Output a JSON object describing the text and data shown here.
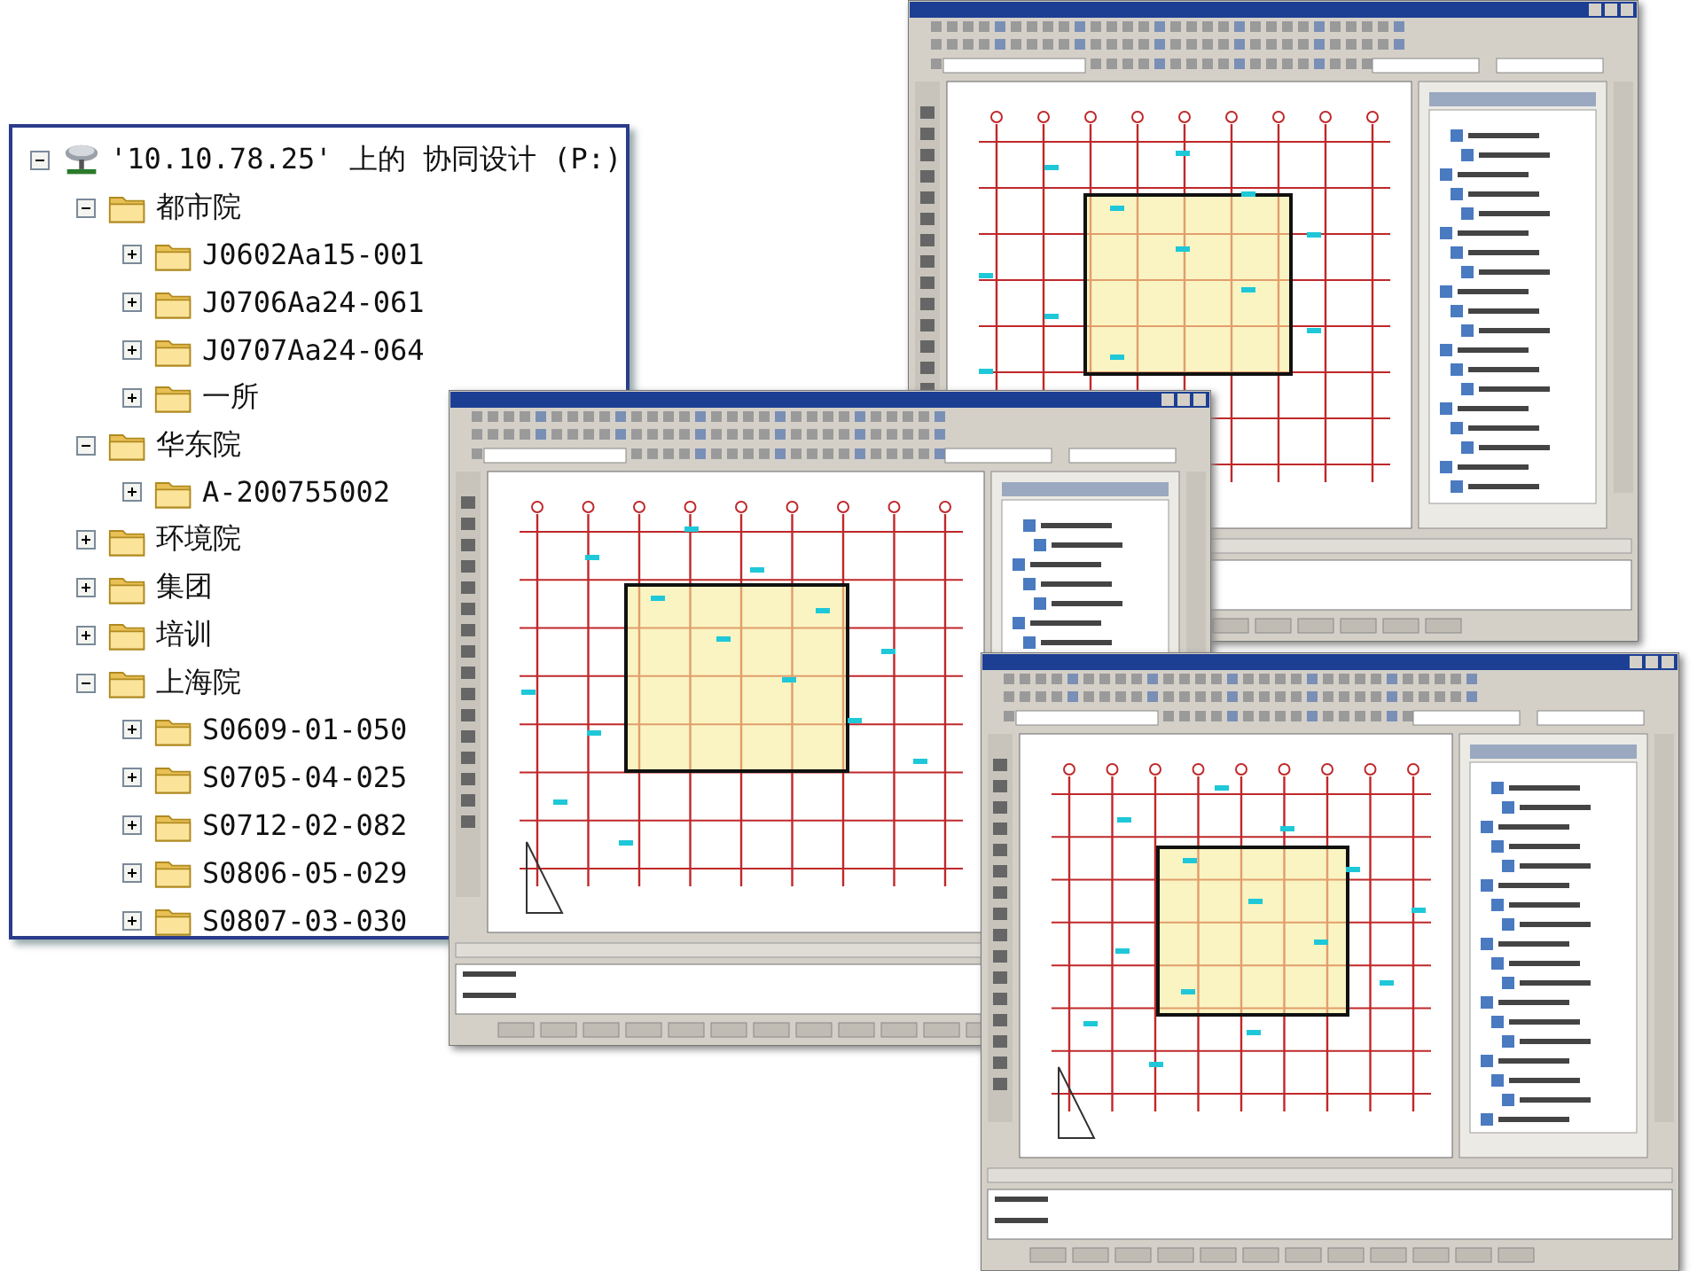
{
  "folder_tree": {
    "root": {
      "label": "'10.10.78.25' 上的 协同设计 (P:)",
      "kind": "network-drive",
      "expanded": true,
      "children": [
        {
          "label": "都市院",
          "kind": "folder",
          "expanded": true,
          "children": [
            {
              "label": "J0602Aa15-001",
              "kind": "folder",
              "expanded": false
            },
            {
              "label": "J0706Aa24-061",
              "kind": "folder",
              "expanded": false
            },
            {
              "label": "J0707Aa24-064",
              "kind": "folder",
              "expanded": false
            },
            {
              "label": "一所",
              "kind": "folder",
              "expanded": false
            }
          ]
        },
        {
          "label": "华东院",
          "kind": "folder",
          "expanded": true,
          "children": [
            {
              "label": "A-200755002",
              "kind": "folder",
              "expanded": false
            }
          ]
        },
        {
          "label": "环境院",
          "kind": "folder",
          "expanded": false
        },
        {
          "label": "集团",
          "kind": "folder",
          "expanded": false
        },
        {
          "label": "培训",
          "kind": "folder",
          "expanded": false
        },
        {
          "label": "上海院",
          "kind": "folder",
          "expanded": true,
          "children": [
            {
              "label": "S0609-01-050",
              "kind": "folder",
              "expanded": false
            },
            {
              "label": "S0705-04-025",
              "kind": "folder",
              "expanded": false
            },
            {
              "label": "S0712-02-082",
              "kind": "folder",
              "expanded": false
            },
            {
              "label": "S0806-05-029",
              "kind": "folder",
              "expanded": false
            },
            {
              "label": "S0807-03-030",
              "kind": "folder",
              "expanded": false
            }
          ]
        }
      ]
    }
  }
}
